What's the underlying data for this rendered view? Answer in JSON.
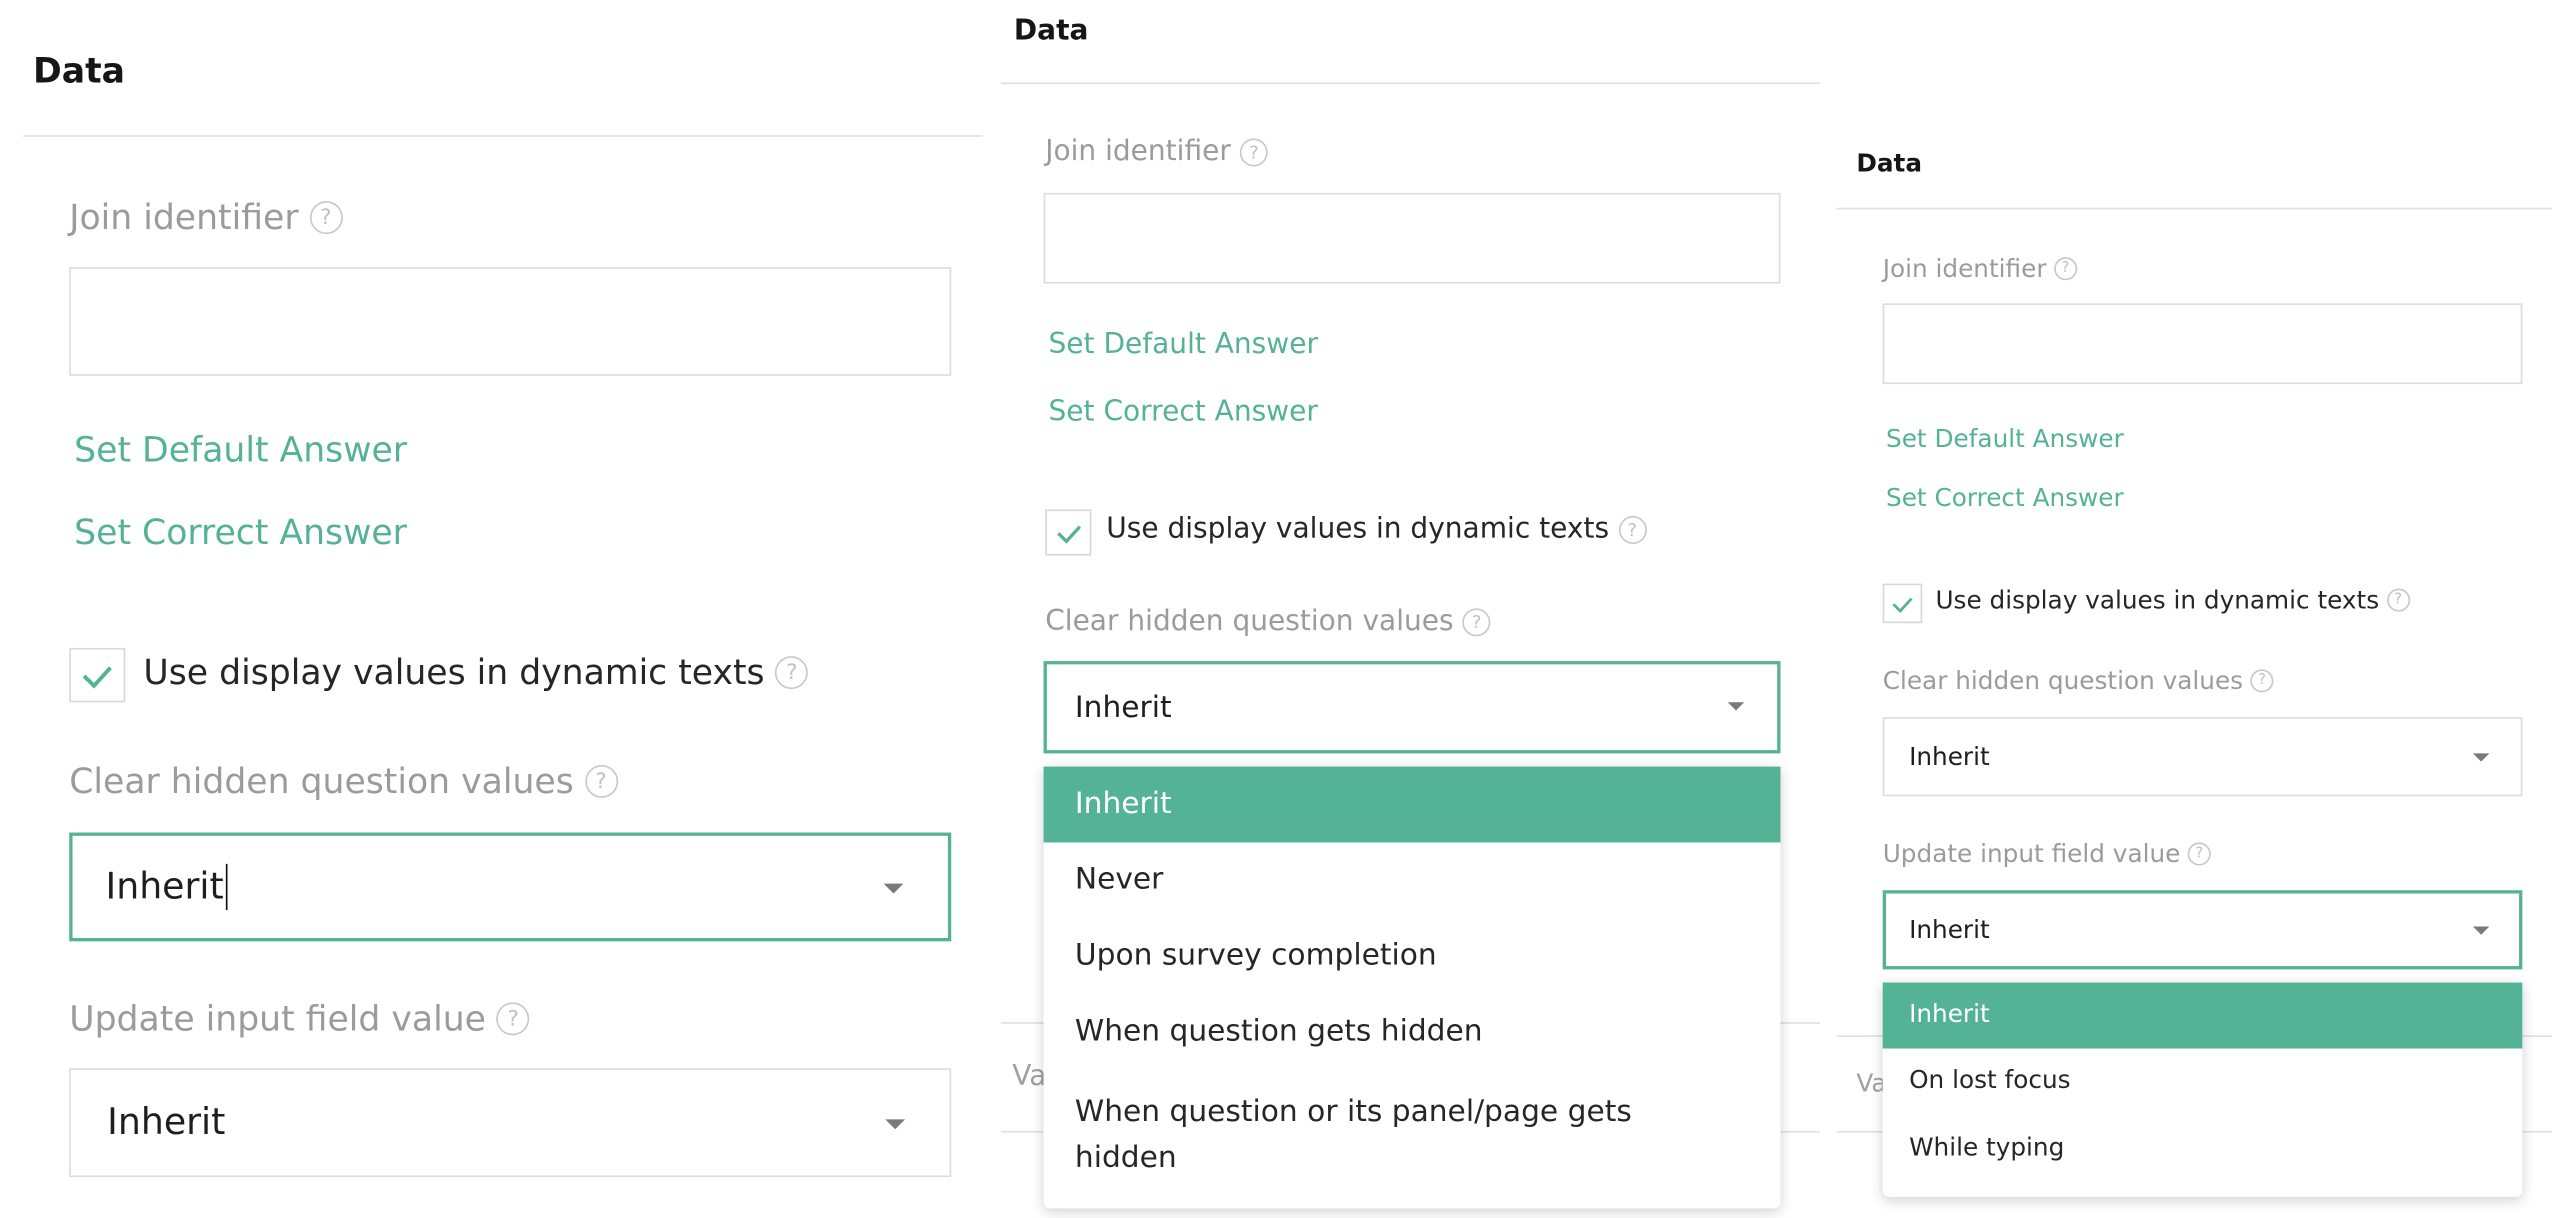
{
  "accent_color": "#54b295",
  "panels": [
    {
      "title": "Data",
      "join_identifier": {
        "label": "Join identifier",
        "value": "",
        "help_icon": "question-circle-icon"
      },
      "links": {
        "set_default": "Set Default Answer",
        "set_correct": "Set Correct Answer"
      },
      "checkbox": {
        "label": "Use display values in dynamic texts",
        "checked": true,
        "icon": "checkmark-icon"
      },
      "clear_hidden": {
        "label": "Clear hidden question values",
        "value": "Inherit",
        "state": "focused-with-text-cursor"
      },
      "update_input": {
        "label": "Update input field value",
        "value": "Inherit"
      }
    },
    {
      "title": "Data",
      "join_identifier": {
        "label": "Join identifier",
        "value": ""
      },
      "links": {
        "set_default": "Set Default Answer",
        "set_correct": "Set Correct Answer"
      },
      "checkbox": {
        "label": "Use display values in dynamic texts",
        "checked": true
      },
      "clear_hidden": {
        "label": "Clear hidden question values",
        "value": "Inherit",
        "state": "open",
        "options": [
          {
            "label": "Inherit",
            "selected": true
          },
          {
            "label": "Never",
            "selected": false
          },
          {
            "label": "Upon survey completion",
            "selected": false
          },
          {
            "label": "When question gets hidden",
            "selected": false
          },
          {
            "label": "When question or its panel/page gets hidden",
            "selected": false
          }
        ]
      },
      "background_section_label": "Va"
    },
    {
      "title": "Data",
      "join_identifier": {
        "label": "Join identifier",
        "value": ""
      },
      "links": {
        "set_default": "Set Default Answer",
        "set_correct": "Set Correct Answer"
      },
      "checkbox": {
        "label": "Use display values in dynamic texts",
        "checked": true
      },
      "clear_hidden": {
        "label": "Clear hidden question values",
        "value": "Inherit"
      },
      "update_input": {
        "label": "Update input field value",
        "value": "Inherit",
        "state": "open",
        "options": [
          {
            "label": "Inherit",
            "selected": true
          },
          {
            "label": "On lost focus",
            "selected": false
          },
          {
            "label": "While typing",
            "selected": false
          }
        ]
      },
      "background_section_label": "Va"
    }
  ]
}
